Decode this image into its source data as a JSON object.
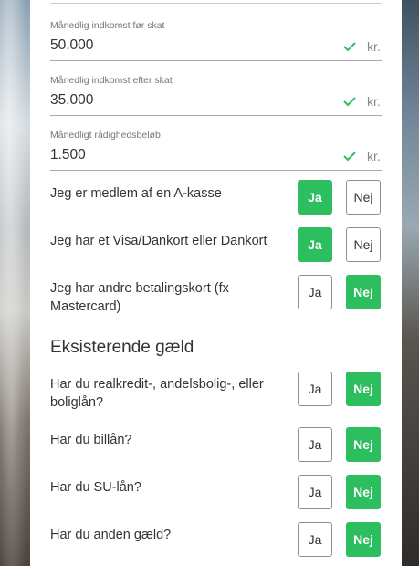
{
  "income_fields": [
    {
      "label": "Månedlig indkomst før skat",
      "value": "50.000",
      "unit": "kr."
    },
    {
      "label": "Månedlig indkomst efter skat",
      "value": "35.000",
      "unit": "kr."
    },
    {
      "label": "Månedligt rådighedsbeløb",
      "value": "1.500",
      "unit": "kr."
    }
  ],
  "questions": [
    {
      "text": "Jeg er medlem af en A-kasse",
      "selected": "Ja"
    },
    {
      "text": "Jeg har et Visa/Dankort eller Dankort",
      "selected": "Ja"
    },
    {
      "text": "Jeg har andre betalingskort (fx Mastercard)",
      "selected": "Nej"
    }
  ],
  "debt_section": {
    "heading": "Eksisterende gæld",
    "questions": [
      {
        "text": "Har du realkredit-, andelsbolig-, eller boliglån?",
        "selected": "Nej"
      },
      {
        "text": "Har du billån?",
        "selected": "Nej"
      },
      {
        "text": "Har du SU-lån?",
        "selected": "Nej"
      },
      {
        "text": "Har du anden gæld?",
        "selected": "Nej"
      }
    ]
  },
  "options": {
    "yes": "Ja",
    "no": "Nej"
  },
  "colors": {
    "accent": "#2dbe60",
    "check": "#2dbe60"
  },
  "icons": {
    "valid": "check-icon"
  }
}
